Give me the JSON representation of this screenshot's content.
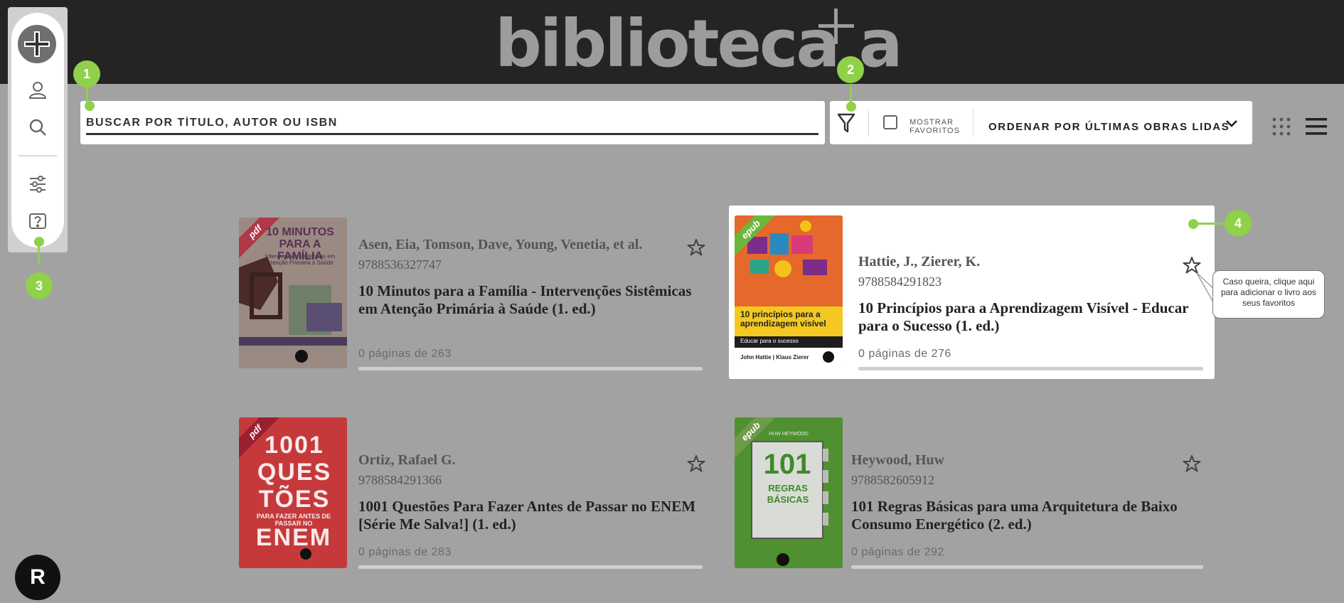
{
  "header": {
    "logo_text": "biblioteca a"
  },
  "sidebar": {
    "items": [
      {
        "icon": "brand-plus-icon"
      },
      {
        "icon": "user-icon"
      },
      {
        "icon": "search-icon"
      },
      {
        "icon": "sliders-icon"
      },
      {
        "icon": "help-icon"
      }
    ]
  },
  "search": {
    "placeholder": "BUSCAR POR TÍTULO, AUTOR OU ISBN"
  },
  "filters": {
    "favorites_label": "MOSTRAR FAVORITOS",
    "sort_label": "ORDENAR POR ÚLTIMAS OBRAS LIDAS"
  },
  "callouts": [
    "1",
    "2",
    "3",
    "4"
  ],
  "tooltip": "Caso queira, clique aqui para adicionar o livro aos seus favoritos",
  "books": [
    {
      "format": "pdf",
      "cover_title": "10 MINUTOS PARA A FAMÍLIA",
      "cover_subtitle": "Intervenções sistêmicas em Atenção Primária à Saúde",
      "authors": "Asen, Eia, Tomson, Dave, Young, Venetia, et al.",
      "isbn": "9788536327747",
      "title": "10 Minutos para a Família - Intervenções Sistêmicas em Atenção Primária à Saúde (1. ed.)",
      "pages": "0 páginas de 263",
      "progress": 0
    },
    {
      "format": "epub",
      "cover_title": "10 princípios para a aprendizagem visível",
      "cover_subtitle": "Educar para o sucesso",
      "cover_authors": "John Hattie | Klaus Zierer",
      "authors": "Hattie, J., Zierer, K.",
      "isbn": "9788584291823",
      "title": "10 Princípios para a Aprendizagem Visível - Educar para o Sucesso (1. ed.)",
      "pages": "0 páginas de 276",
      "progress": 0
    },
    {
      "format": "pdf",
      "cover_title": "1001 QUES TÕES",
      "cover_subtitle": "PARA FAZER ANTES DE PASSAR NO",
      "cover_title2": "ENEM",
      "authors": "Ortiz, Rafael G.",
      "isbn": "9788584291366",
      "title": "1001 Questões Para Fazer Antes de Passar no ENEM [Série Me Salva!] (1. ed.)",
      "pages": "0 páginas de 283",
      "progress": 0
    },
    {
      "format": "epub",
      "cover_author": "HUW HEYWOOD",
      "cover_title": "101",
      "cover_title2": "REGRAS BÁSICAS",
      "authors": "Heywood, Huw",
      "isbn": "9788582605912",
      "title": "101 Regras Básicas para uma Arquitetura de Baixo Consumo Energético (2. ed.)",
      "pages": "0 páginas de 292",
      "progress": 0
    }
  ],
  "footer_logo": "R"
}
